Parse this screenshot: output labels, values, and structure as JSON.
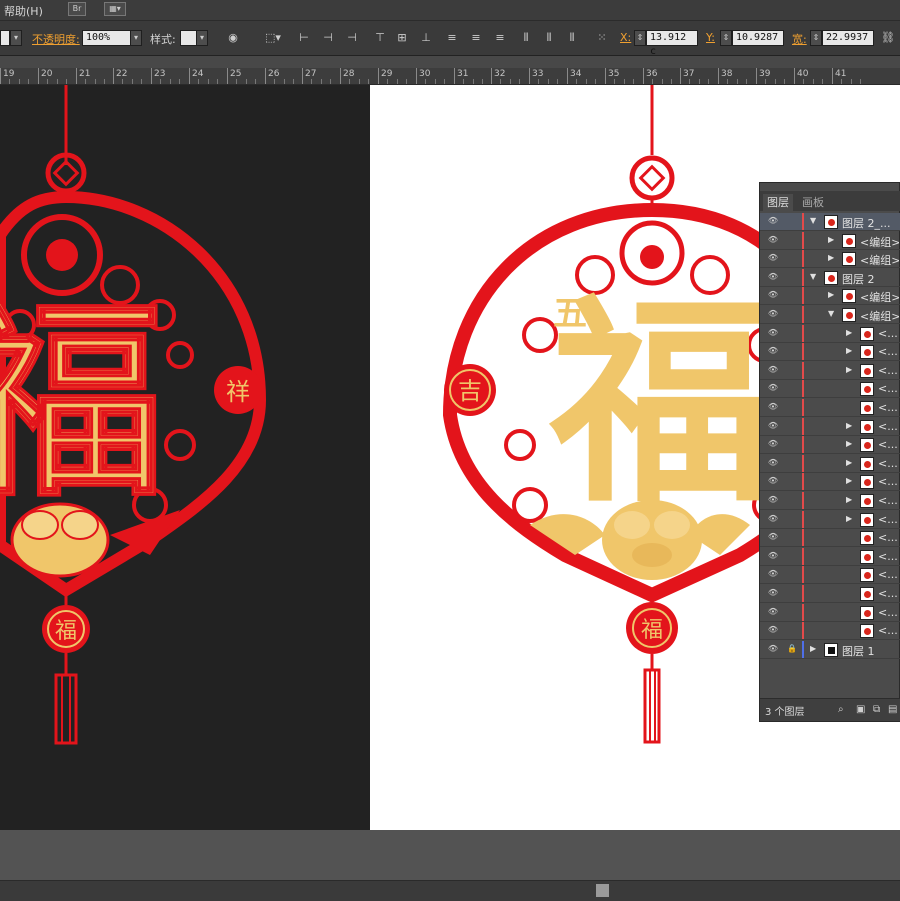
{
  "menubar": {
    "help": "帮助(H)",
    "br_label": "Br"
  },
  "controlbar": {
    "opacity_label": "不透明度:",
    "opacity_value": "100%",
    "style_label": "样式:",
    "x_label": "X:",
    "x_value": "13.912 c",
    "y_label": "Y:",
    "y_value": "10.9287",
    "w_label": "宽:",
    "w_value": "22.9937"
  },
  "ruler": {
    "labels": [
      "19",
      "20",
      "21",
      "22",
      "23",
      "24",
      "25",
      "26",
      "27",
      "28",
      "29",
      "30",
      "31",
      "32",
      "33",
      "34",
      "35",
      "36",
      "37",
      "38",
      "39",
      "40",
      "41"
    ]
  },
  "layers_panel": {
    "tabs": [
      "图层",
      "画板"
    ],
    "rows": [
      {
        "name": "图层 2_...",
        "type": "layer"
      },
      {
        "name": "<编组>",
        "type": "group"
      },
      {
        "name": "<编组>",
        "type": "group"
      },
      {
        "name": "图层 2",
        "type": "layer"
      },
      {
        "name": "<编组>",
        "type": "group"
      },
      {
        "name": "<编组>",
        "type": "group"
      },
      {
        "name": "<...",
        "type": "item"
      },
      {
        "name": "<...",
        "type": "item"
      },
      {
        "name": "<...",
        "type": "item"
      },
      {
        "name": "<...",
        "type": "item"
      },
      {
        "name": "<...",
        "type": "item"
      },
      {
        "name": "<...",
        "type": "item"
      },
      {
        "name": "<...",
        "type": "item"
      },
      {
        "name": "<...",
        "type": "item"
      },
      {
        "name": "<...",
        "type": "item"
      },
      {
        "name": "<...",
        "type": "item"
      },
      {
        "name": "<...",
        "type": "item"
      },
      {
        "name": "<...",
        "type": "item"
      },
      {
        "name": "<...",
        "type": "item"
      },
      {
        "name": "<...",
        "type": "item"
      },
      {
        "name": "<...",
        "type": "item"
      },
      {
        "name": "<...",
        "type": "item"
      },
      {
        "name": "<...",
        "type": "item"
      },
      {
        "name": "图层 1",
        "type": "layer"
      }
    ],
    "footer": "3 个图层"
  },
  "artwork": {
    "main_char": "福",
    "side_char": "吉",
    "side_char_left": "祥",
    "small_char": "福",
    "top_char": "五"
  },
  "colors": {
    "red": "#e3141b",
    "gold": "#f0c66a",
    "dark_canvas": "#222222"
  }
}
